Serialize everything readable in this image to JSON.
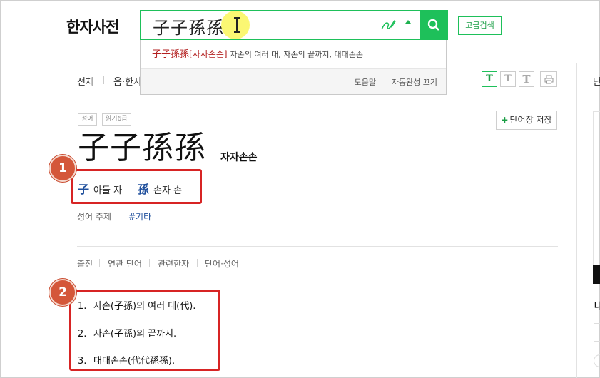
{
  "header": {
    "logo": "한자사전",
    "search": {
      "value": "子子孫孫",
      "handwrite_icon": "handwriting-icon",
      "search_icon": "magnifier-icon"
    },
    "advanced_search": "고급검색"
  },
  "autocomplete": {
    "suggestion": {
      "hanja": "子子孫孫",
      "reading": "[자자손손]",
      "meaning": "자손의 여러 대, 자손의 끝까지, 대대손손"
    },
    "help": "도움말",
    "autocomplete_off": "자동완성 끄기"
  },
  "filter_tabs": [
    "전체",
    "음·한자"
  ],
  "font_buttons": [
    "T",
    "T",
    "T"
  ],
  "right_column": {
    "tab_partial": "단",
    "text_partial": "나"
  },
  "entry": {
    "badges": [
      "성어",
      "읽기6급"
    ],
    "save_label": "단어장 저장",
    "save_plus": "+",
    "hanja": "子子孫孫",
    "reading": "자자손손",
    "components": [
      {
        "hanja": "子",
        "meaning": "아들 자"
      },
      {
        "hanja": "孫",
        "meaning": "손자 손"
      }
    ],
    "topic_label": "성어 주제",
    "topic_tag": "#기타"
  },
  "sub_tabs": [
    "출전",
    "연관 단어",
    "관련한자",
    "단어·성어"
  ],
  "definitions": [
    {
      "num": "1.",
      "text": "자손(子孫)의 여러 대(代)."
    },
    {
      "num": "2.",
      "text": "자손(子孫)의 끝까지."
    },
    {
      "num": "3.",
      "text": "대대손손(代代孫孫)."
    }
  ],
  "callouts": [
    "1",
    "2"
  ],
  "colors": {
    "accent_green": "#1ec05a",
    "highlight_red": "#d72424",
    "callout_orange": "#d4573a",
    "hanja_blue": "#1f4f9c",
    "suggestion_red": "#b31f1f"
  }
}
